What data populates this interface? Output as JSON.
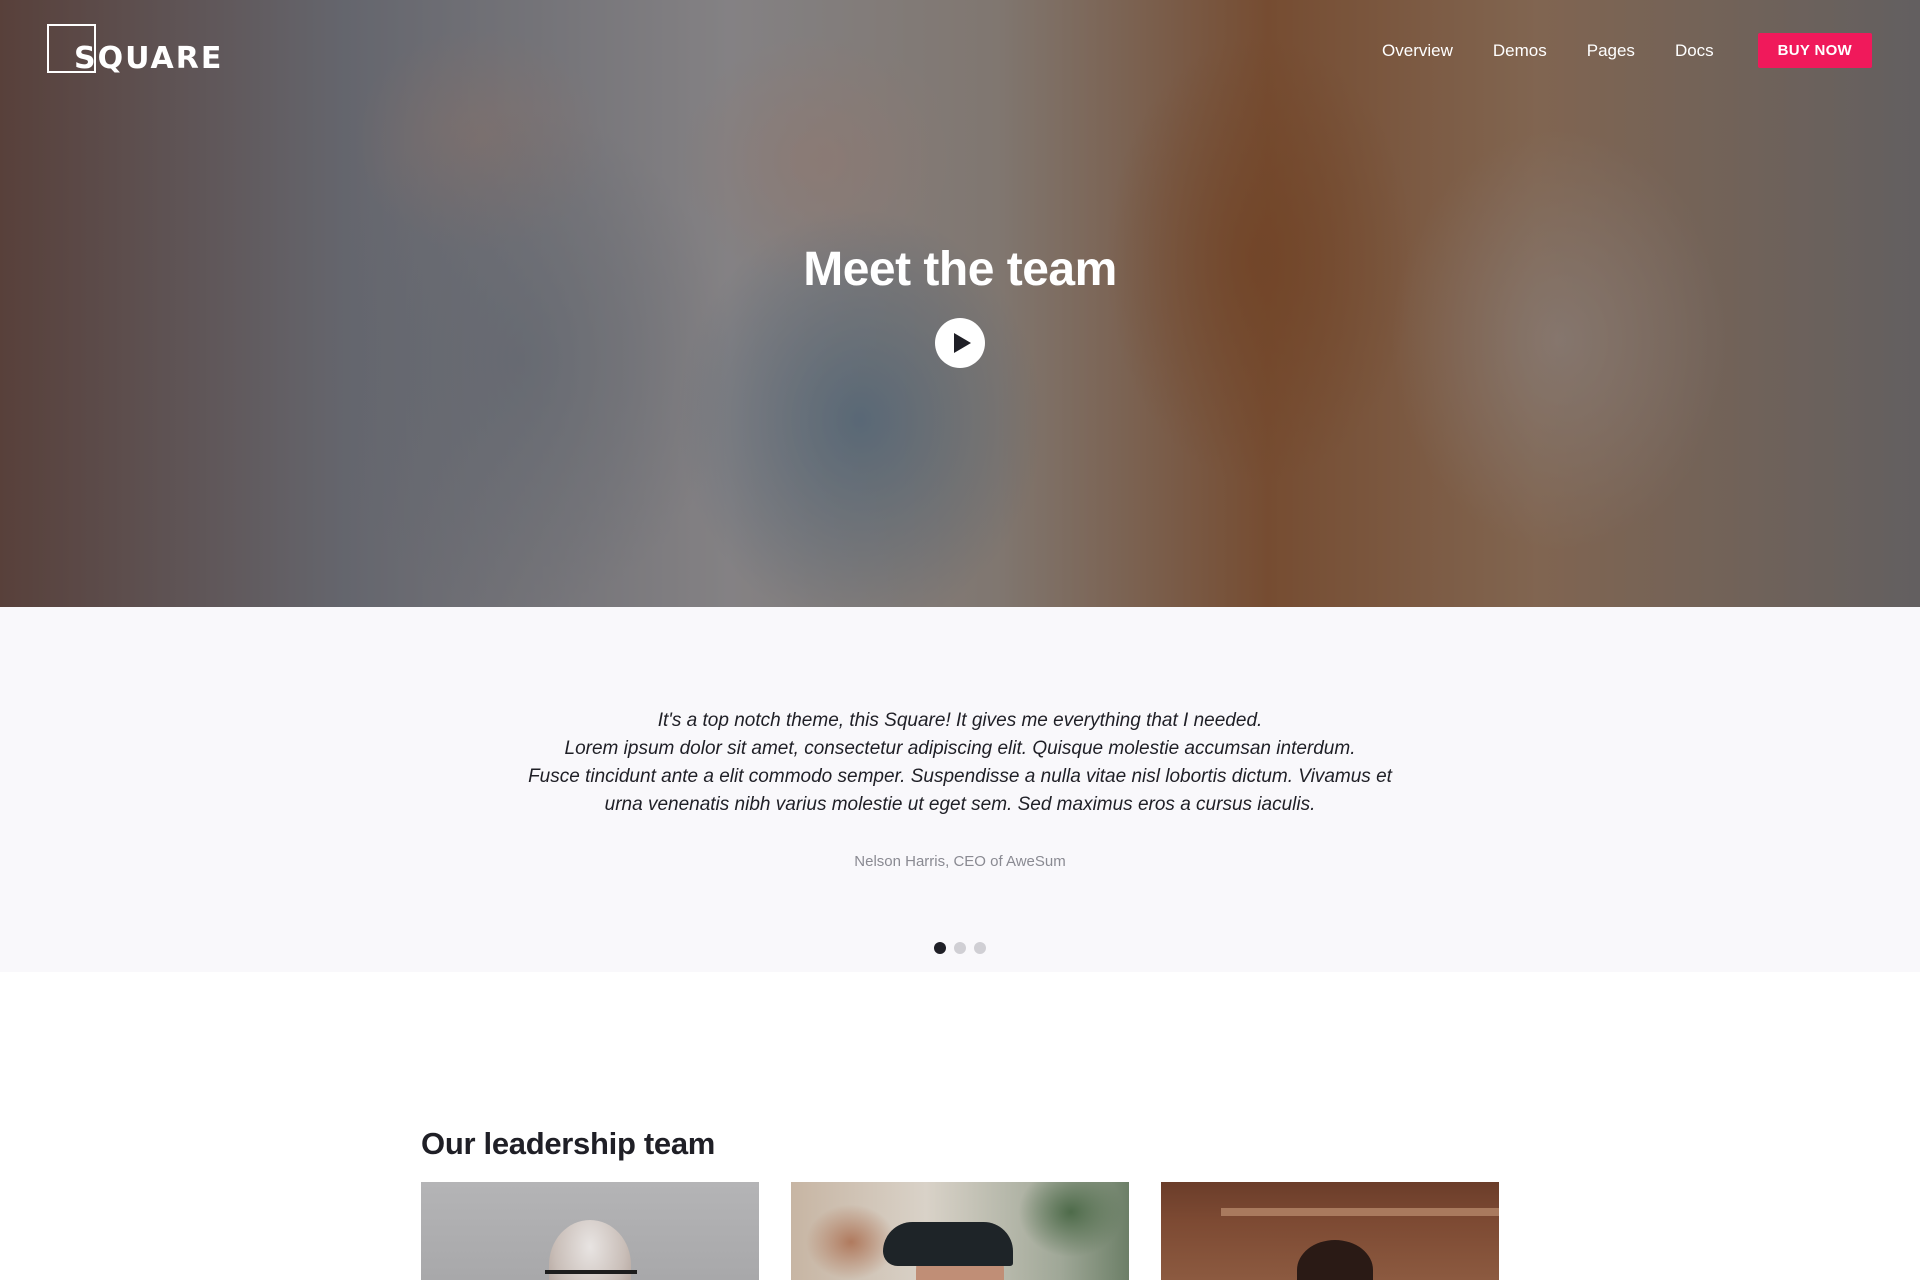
{
  "brand": {
    "logo_text": "SQUARE"
  },
  "nav": {
    "items": [
      {
        "label": "Overview"
      },
      {
        "label": "Demos"
      },
      {
        "label": "Pages"
      },
      {
        "label": "Docs"
      }
    ],
    "cta_label": "BUY NOW"
  },
  "hero": {
    "title": "Meet the team"
  },
  "testimonial": {
    "quote_lines": [
      "It's a top notch theme, this Square! It gives me everything that I needed.",
      "Lorem ipsum dolor sit amet, consectetur adipiscing elit. Quisque molestie accumsan interdum.",
      "Fusce tincidunt ante a elit commodo semper. Suspendisse a nulla vitae nisl lobortis dictum. Vivamus et",
      "urna venenatis nibh varius molestie ut eget sem. Sed maximus eros a cursus iaculis."
    ],
    "author": "Nelson Harris, CEO of AweSum",
    "slide_count": 3,
    "active_slide": 1
  },
  "leadership": {
    "title": "Our leadership team"
  },
  "colors": {
    "accent": "#f0195b",
    "text_dark": "#1f1f26",
    "muted": "#8a8a92",
    "testimonial_bg": "#f9f8fb"
  },
  "icons": {
    "play": "play-icon"
  }
}
